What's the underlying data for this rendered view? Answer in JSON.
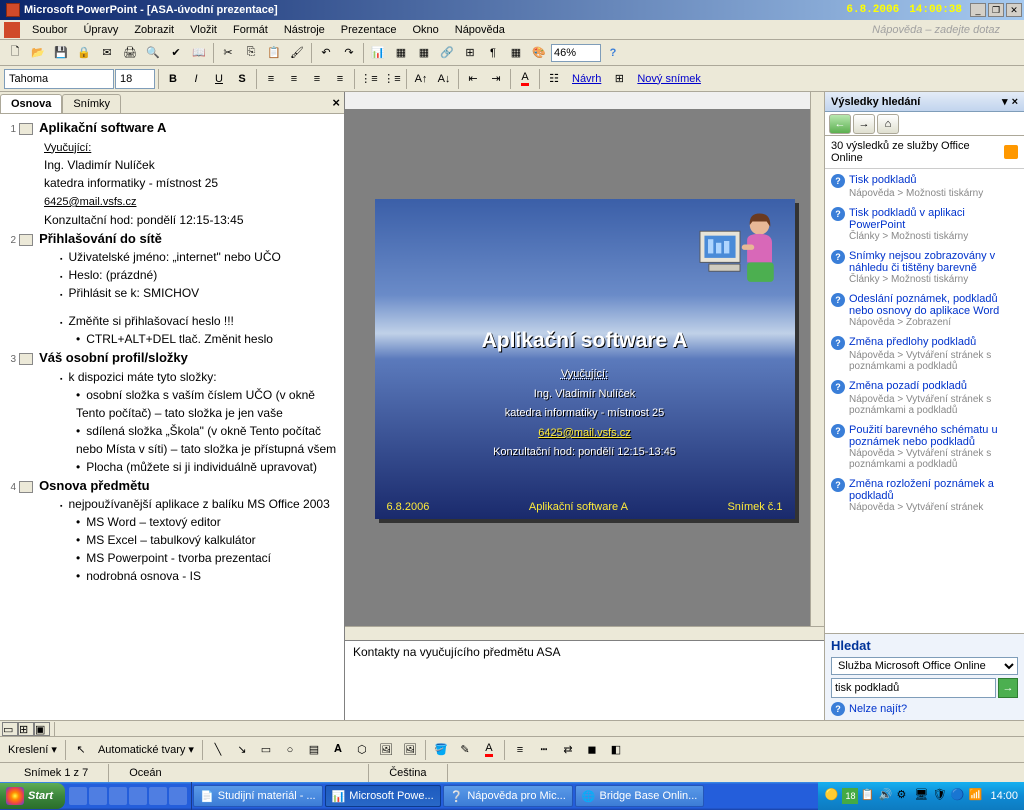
{
  "titlebar": {
    "app": "Microsoft PowerPoint - [ASA-úvodní prezentace]",
    "date": "6.8.2006",
    "time": "14:00:38"
  },
  "menu": {
    "items": [
      "Soubor",
      "Úpravy",
      "Zobrazit",
      "Vložit",
      "Formát",
      "Nástroje",
      "Prezentace",
      "Okno",
      "Nápověda"
    ],
    "help_prompt": "Nápověda – zadejte dotaz"
  },
  "toolbar1": {
    "zoom": "46%"
  },
  "toolbar2": {
    "font": "Tahoma",
    "size": "18",
    "design": "Návrh",
    "new_slide": "Nový snímek"
  },
  "outline": {
    "tab_outline": "Osnova",
    "tab_slides": "Snímky",
    "slides": [
      {
        "num": "1",
        "title": "Aplikační software A",
        "body": [
          {
            "t": "text",
            "v": "Vyučující:",
            "u": true
          },
          {
            "t": "text",
            "v": "Ing. Vladimír Nulíček"
          },
          {
            "t": "text",
            "v": "katedra informatiky - místnost 25"
          },
          {
            "t": "text",
            "v": "6425@mail.vsfs.cz",
            "u": true
          },
          {
            "t": "text",
            "v": "Konzultační hod: pondělí 12:15-13:45"
          }
        ]
      },
      {
        "num": "2",
        "title": "Přihlašování do sítě",
        "body": [
          {
            "t": "b1",
            "v": "Uživatelské jméno: „internet\" nebo UČO"
          },
          {
            "t": "b1",
            "v": "Heslo: (prázdné)"
          },
          {
            "t": "b1",
            "v": "Přihlásit se k: SMICHOV"
          },
          {
            "t": "sp"
          },
          {
            "t": "b1",
            "v": "Změňte si přihlašovací heslo !!!"
          },
          {
            "t": "b2",
            "v": "CTRL+ALT+DEL  tlač. Změnit heslo"
          }
        ]
      },
      {
        "num": "3",
        "title": "Váš osobní profil/složky",
        "body": [
          {
            "t": "b1",
            "v": "k dispozici máte tyto složky:"
          },
          {
            "t": "b2",
            "v": "osobní složka s vaším číslem UČO (v okně Tento počítač) – tato složka je jen vaše"
          },
          {
            "t": "b2",
            "v": "sdílená složka „Škola\" (v okně Tento počítač nebo Místa v síti) – tato složka je přístupná všem"
          },
          {
            "t": "b2",
            "v": "Plocha (můžete si ji individuálně upravovat)"
          }
        ]
      },
      {
        "num": "4",
        "title": "Osnova předmětu",
        "body": [
          {
            "t": "b1",
            "v": "nejpoužívanější aplikace z balíku MS Office 2003"
          },
          {
            "t": "b2",
            "v": "MS Word – textový editor"
          },
          {
            "t": "b2",
            "v": "MS Excel – tabulkový kalkulátor"
          },
          {
            "t": "b2",
            "v": "MS Powerpoint - tvorba prezentací"
          },
          {
            "t": "b2",
            "v": "nodrobná osnova - IS"
          }
        ]
      }
    ]
  },
  "slide": {
    "title": "Aplikační software A",
    "lines": {
      "l1": "Vyučující:",
      "l2": "Ing. Vladimír Nulíček",
      "l3": "katedra informatiky - místnost 25",
      "l4": "6425@mail.vsfs.cz",
      "l5": "Konzultační hod: pondělí 12:15-13:45"
    },
    "footer_left": "6.8.2006",
    "footer_center": "Aplikační software A",
    "footer_right": "Snímek č.1"
  },
  "notes": "Kontakty na vyučujícího předmětu ASA",
  "task_pane": {
    "header": "Výsledky hledání",
    "count": "30 výsledků ze služby Office Online",
    "results": [
      {
        "title": "Tisk podkladů",
        "meta": "Nápověda > Možnosti tiskárny"
      },
      {
        "title": "Tisk podkladů v aplikaci PowerPoint",
        "meta": "Články > Možnosti tiskárny"
      },
      {
        "title": "Snímky nejsou zobrazovány v náhledu či tištěny barevně",
        "meta": "Články > Možnosti tiskárny"
      },
      {
        "title": "Odeslání poznámek, podkladů nebo osnovy do aplikace Word",
        "meta": "Nápověda > Zobrazení"
      },
      {
        "title": "Změna předlohy podkladů",
        "meta": "Nápověda > Vytváření stránek s poznámkami a podkladů"
      },
      {
        "title": "Změna pozadí podkladů",
        "meta": "Nápověda > Vytváření stránek s poznámkami a podkladů"
      },
      {
        "title": "Použití barevného schématu u poznámek nebo podkladů",
        "meta": "Nápověda > Vytváření stránek s poznámkami a podkladů"
      },
      {
        "title": "Změna rozložení poznámek a podkladů",
        "meta": "Nápověda > Vytváření stránek"
      }
    ],
    "search_label": "Hledat",
    "search_scope": "Služba Microsoft Office Online",
    "search_value": "tisk podkladů",
    "cannot_find": "Nelze najít?"
  },
  "drawing": {
    "label": "Kreslení",
    "autoshapes": "Automatické tvary"
  },
  "status": {
    "slide": "Snímek 1 z 7",
    "design": "Oceán",
    "lang": "Čeština"
  },
  "taskbar": {
    "start": "Start",
    "tasks": [
      "Studijní materiál - ...",
      "Microsoft Powe...",
      "Nápověda pro Mic...",
      "Bridge Base Onlin..."
    ],
    "time": "14:00"
  }
}
